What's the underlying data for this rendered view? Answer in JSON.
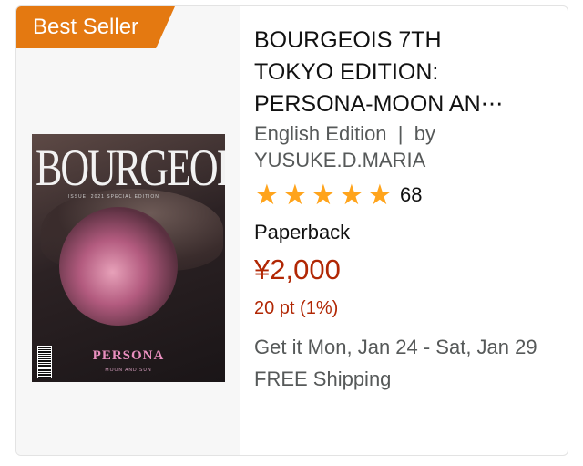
{
  "badge": {
    "label": "Best Seller",
    "color": "#e47911"
  },
  "product": {
    "title_lines": [
      "BOURGEOIS 7TH",
      "TOKYO EDITION:",
      "PERSONA-MOON AN⋯"
    ],
    "edition": "English Edition",
    "separator": "|",
    "by_label": "by",
    "author": "YUSUKE.D.MARIA",
    "rating": {
      "stars": 5,
      "max": 5,
      "count": "68",
      "star_icon": "star-icon",
      "color": "#ffa41c"
    },
    "format": "Paperback",
    "price": "¥2,000",
    "points": "20 pt (1%)",
    "delivery": "Get it Mon, Jan 24 - Sat, Jan 29",
    "shipping": "FREE Shipping",
    "price_color": "#b12704"
  },
  "cover": {
    "masthead": "BOURGEOIS",
    "subline": "ISSUE, 2021 SPECIAL EDITION",
    "feature": "PERSONA",
    "feature_sub": "MOON AND SUN"
  }
}
